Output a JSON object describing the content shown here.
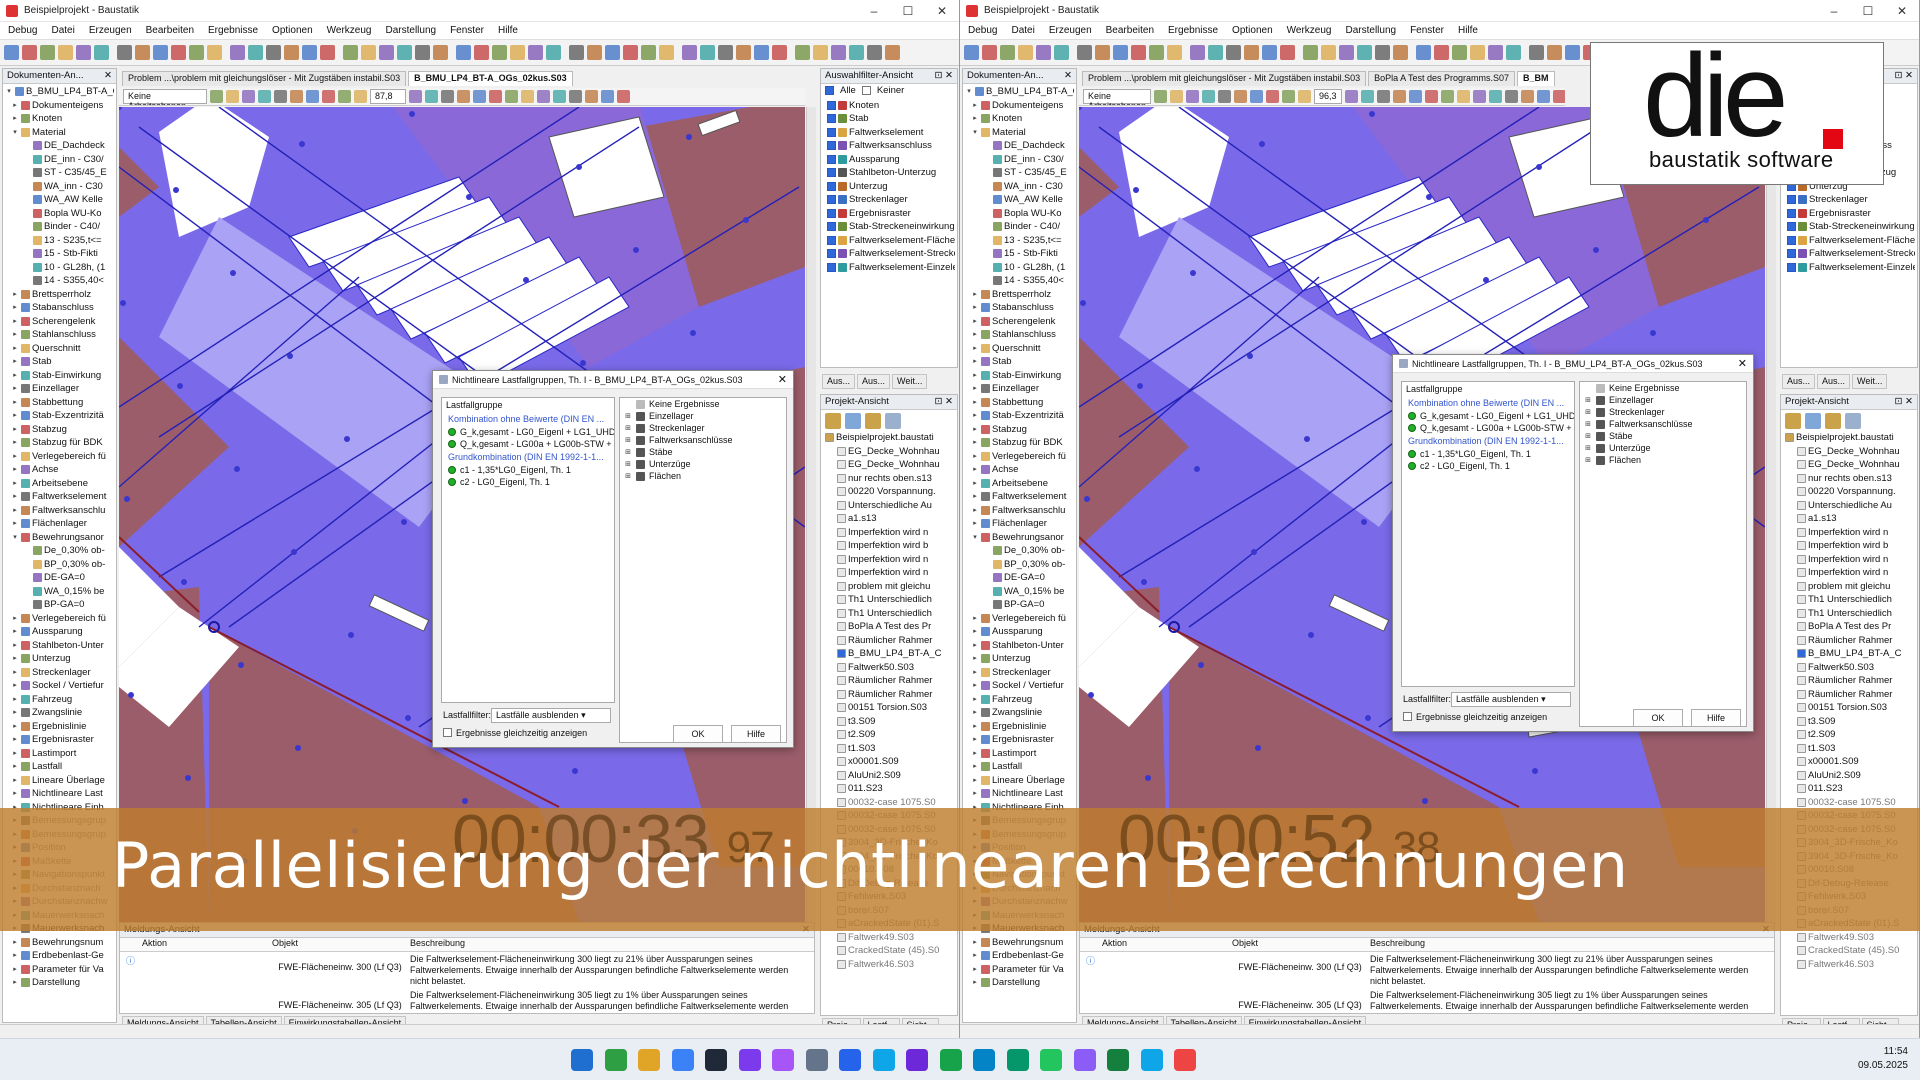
{
  "windows": [
    {
      "title": "Beispielprojekt - Baustatik",
      "tabs": [
        "Problem ...\\problem mit gleichungslöser - Mit Zugstäben instabil.S03",
        "B_BMU_LP4_BT-A_OGs_02kus.S03"
      ],
      "zoom": "87,8",
      "dialog_title": "Nichtlineare Lastfallgruppen, Th. I - B_BMU_LP4_BT-A_OGs_02kus.S03"
    },
    {
      "title": "Beispielprojekt - Baustatik",
      "tabs": [
        "Problem ...\\problem mit gleichungslöser - Mit Zugstäben instabil.S03",
        "BoPla A Test des Programms.S07",
        "B_BM"
      ],
      "zoom": "96,3",
      "dialog_title": "Nichtlineare Lastfallgruppen, Th. I - B_BMU_LP4_BT-A_OGs_02kus.S03"
    }
  ],
  "menu": [
    "Debug",
    "Datei",
    "Erzeugen",
    "Bearbeiten",
    "Ergebnisse",
    "Optionen",
    "Werkzeug",
    "Darstellung",
    "Fenster",
    "Hilfe"
  ],
  "doc_panel": {
    "title": "Dokumenten-An...",
    "items": [
      "B_BMU_LP4_BT-A_O",
      "Dokumenteigens",
      "Knoten",
      "Material",
      "DE_Dachdeck",
      "DE_inn - C30/",
      "ST - C35/45_E",
      "WA_inn - C30",
      "WA_AW Kelle",
      "Bopla WU-Ko",
      "Binder - C40/",
      "13 - S235,t<=",
      "15 - Stb-Fikti",
      "10 - GL28h, (1",
      "14 - S355,40<",
      "Brettsperrholz",
      "Stabanschluss",
      "Scherengelenk",
      "Stahlanschluss",
      "Querschnitt",
      "Stab",
      "Stab-Einwirkung",
      "Einzellager",
      "Stabbettung",
      "Stab-Exzentrizitä",
      "Stabzug",
      "Stabzug für BDK",
      "Verlegebereich fü",
      "Achse",
      "Arbeitsebene",
      "Faltwerkselement",
      "Faltwerksanschlu",
      "Flächenlager",
      "Bewehrungsanor",
      "De_0,30% ob-",
      "BP_0,30% ob-",
      "DE-GA=0",
      "WA_0,15% be",
      "BP-GA=0",
      "Verlegebereich fü",
      "Aussparung",
      "Stahlbeton-Unter",
      "Unterzug",
      "Streckenlager",
      "Sockel / Vertiefur",
      "Fahrzeug",
      "Zwangslinie",
      "Ergebnislinie",
      "Ergebnisraster",
      "Lastimport",
      "Lastfall",
      "Lineare Überlage",
      "Nichtlineare Last",
      "Nichtlineare Einh",
      "Bemessungsgrup",
      "Bemessungsgrup",
      "Position",
      "Maßkette",
      "Navigationspunkt",
      "Durchstanznach",
      "Durchstanznachw",
      "Mauerwerksnach",
      "Mauerwerksnach",
      "Bewehrungsnum",
      "Erdbebenlast-Ge",
      "Parameter für Va",
      "Darstellung"
    ]
  },
  "cad_toolbar": {
    "label": "Keine Arbeitsebenen"
  },
  "filter_panel": {
    "title": "Auswahlfilter-Ansicht",
    "all": "Alle",
    "none": "Keiner",
    "items": [
      "Knoten",
      "Stab",
      "Faltwerkselement",
      "Faltwerksanschluss",
      "Aussparung",
      "Stahlbeton-Unterzug",
      "Unterzug",
      "Streckenlager",
      "Ergebnisraster",
      "Stab-Streckeneinwirkung",
      "Faltwerkselement-Flächenei",
      "Faltwerkselement-Strecken",
      "Faltwerkselement-Einzelein"
    ],
    "tabs": [
      "Aus...",
      "Aus...",
      "Weit..."
    ]
  },
  "project_panel": {
    "title": "Projekt-Ansicht",
    "items": [
      "Beispielprojekt.baustati",
      "EG_Decke_Wohnhau",
      "EG_Decke_Wohnhau",
      "nur rechts oben.s13",
      "00220 Vorspannung.",
      "Unterschiedliche Au",
      "a1.s13",
      "Imperfektion wird n",
      "Imperfektion wird b",
      "Imperfektion wird n",
      "Imperfektion wird n",
      "problem mit gleichu",
      "Th1 Unterschiedlich",
      "Th1 Unterschiedlich",
      "BoPla A Test des Pr",
      "Räumlicher Rahmer",
      "B_BMU_LP4_BT-A_C",
      "Faltwerk50.S03",
      "Räumlicher Rahmer",
      "Räumlicher Rahmer",
      "00151 Torsion.S03",
      "t3.S09",
      "t2.S09",
      "t1.S03",
      "x00001.S09",
      "AluUni2.S09",
      "011.S23",
      "00032-case 1075.S0",
      "00032-case 1075.S0",
      "00032-case 1075.S0",
      "3904_3D-Frische_Ko",
      "3904_3D-Frische_Ko",
      "00010.S08",
      "Dif-Debug-Release.",
      "Fehlwerk.S03",
      "borer.S07",
      "aCrackedState (01).S",
      "Faltwerk49.S03",
      "CrackedState (45).S0",
      "Faltwerk46.S03"
    ],
    "tabs": [
      "Proje...",
      "Lastf...",
      "Sicht..."
    ]
  },
  "dialog": {
    "group_label": "Lastfallgruppe",
    "sections": [
      {
        "title": "Kombination ohne Beiwerte (DIN EN ...",
        "items": [
          "G_k,gesamt - LG0_Eigenl + LG1_UHD...",
          "Q_k,gesamt - LG00a + LG00b-STW + ..."
        ]
      },
      {
        "title": "Grundkombination (DIN EN 1992-1-1...",
        "items": [
          "c1 - 1,35*LG0_Eigenl, Th. 1",
          "c2 - LG0_Eigenl, Th. 1"
        ]
      }
    ],
    "results": [
      "Keine Ergebnisse",
      "Einzellager",
      "Streckenlager",
      "Faltwerksanschlüsse",
      "Stäbe",
      "Unterzüge",
      "Flächen"
    ],
    "filter_label": "Lastfallfilter:",
    "filter_value": "Lastfälle ausblenden",
    "checkbox_label": "Ergebnisse gleichzeitig anzeigen",
    "ok": "OK",
    "help": "Hilfe"
  },
  "message_panel": {
    "title": "Meldungs-Ansicht",
    "columns": [
      "Aktion",
      "Objekt",
      "Beschreibung"
    ],
    "rows": [
      {
        "objekt": "FWE-Flächeneinw. 300 (Lf Q3)",
        "text": "Die Faltwerkselement-Flächeneinwirkung 300 liegt zu 21% über Aussparungen seines Faltwerkelements. Etwaige innerhalb der Aussparungen befindliche Faltwerkselemente werden nicht belastet."
      },
      {
        "objekt": "FWE-Flächeneinw. 305 (Lf Q3)",
        "text": "Die Faltwerkselement-Flächeneinwirkung 305 liegt zu 1% über Aussparungen seines Faltwerkelements. Etwaige innerhalb der Aussparungen befindliche Faltwerkselemente werden"
      }
    ],
    "tabs": [
      "Meldungs-Ansicht",
      "Tabellen-Ansicht",
      "Einwirkungstabellen-Ansicht"
    ]
  },
  "timers": [
    {
      "main": "00:00:33",
      "frac": "97"
    },
    {
      "main": "00:00:52",
      "frac": "38"
    }
  ],
  "banner": "Parallelisierung der nichtlinearen Berechnungen",
  "brand": {
    "name": "die",
    "tagline": "baustatik software",
    "accent": "#e30613"
  },
  "clock": {
    "time": "11:54",
    "date": "09.05.2025"
  }
}
